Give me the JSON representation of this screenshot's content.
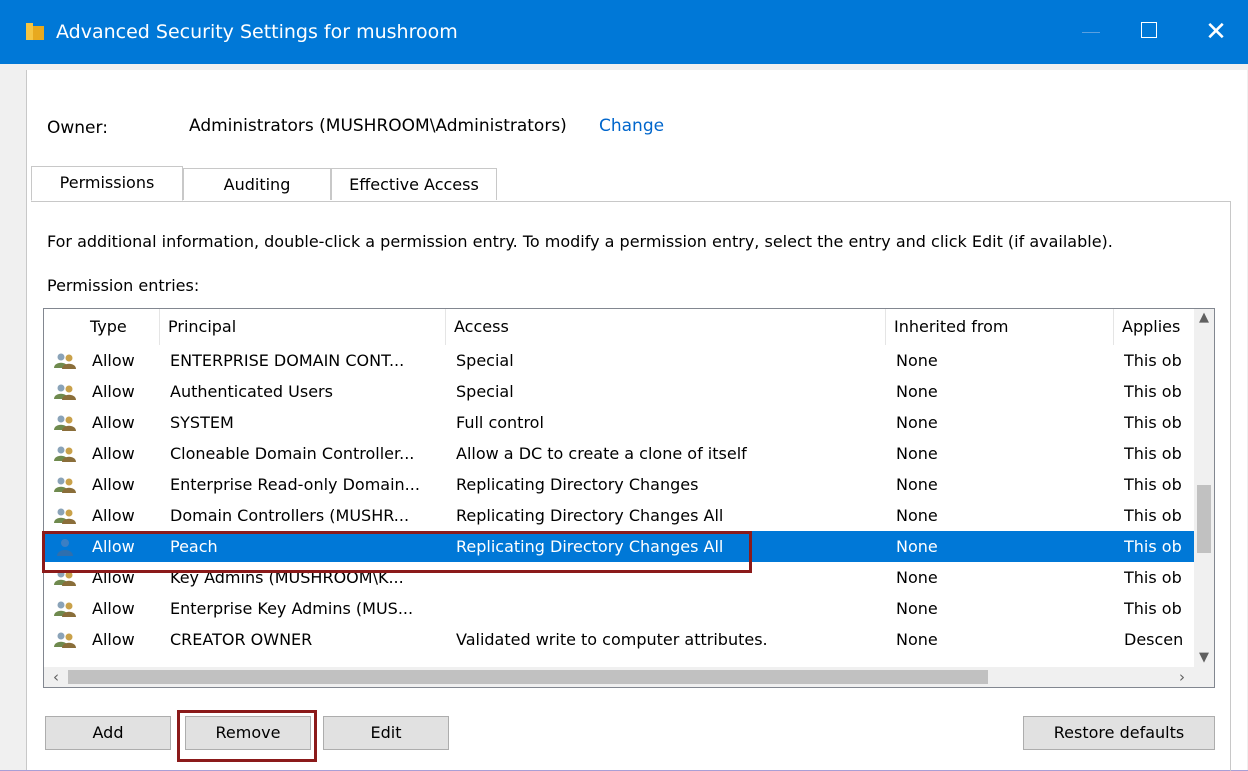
{
  "window": {
    "title": "Advanced Security Settings for mushroom",
    "close_glyph": "✕"
  },
  "owner": {
    "label": "Owner:",
    "value": "Administrators (MUSHROOM\\Administrators)",
    "change_link": "Change"
  },
  "tabs": [
    {
      "label": "Permissions",
      "active": true
    },
    {
      "label": "Auditing",
      "active": false
    },
    {
      "label": "Effective Access",
      "active": false
    }
  ],
  "info_text": "For additional information, double-click a permission entry. To modify a permission entry, select the entry and click Edit (if available).",
  "entries_label": "Permission entries:",
  "columns": [
    "Type",
    "Principal",
    "Access",
    "Inherited from",
    "Applies"
  ],
  "rows": [
    {
      "icon": "group-icon",
      "type": "Allow",
      "principal": "ENTERPRISE DOMAIN CONT...",
      "access": "Special",
      "inherited": "None",
      "applies": "This ob"
    },
    {
      "icon": "group-icon",
      "type": "Allow",
      "principal": "Authenticated Users",
      "access": "Special",
      "inherited": "None",
      "applies": "This ob"
    },
    {
      "icon": "group-icon",
      "type": "Allow",
      "principal": "SYSTEM",
      "access": "Full control",
      "inherited": "None",
      "applies": "This ob"
    },
    {
      "icon": "group-icon",
      "type": "Allow",
      "principal": "Cloneable Domain Controller...",
      "access": "Allow a DC to create a clone of itself",
      "inherited": "None",
      "applies": "This ob"
    },
    {
      "icon": "group-icon",
      "type": "Allow",
      "principal": "Enterprise Read-only Domain...",
      "access": "Replicating Directory Changes",
      "inherited": "None",
      "applies": "This ob"
    },
    {
      "icon": "group-icon",
      "type": "Allow",
      "principal": "Domain Controllers (MUSHR...",
      "access": "Replicating Directory Changes All",
      "inherited": "None",
      "applies": "This ob"
    },
    {
      "icon": "user-icon",
      "type": "Allow",
      "principal": "Peach",
      "access": "Replicating Directory Changes All",
      "inherited": "None",
      "applies": "This ob",
      "selected": true
    },
    {
      "icon": "group-icon",
      "type": "Allow",
      "principal": "Key Admins (MUSHROOM\\K...",
      "access": "",
      "inherited": "None",
      "applies": "This ob"
    },
    {
      "icon": "group-icon",
      "type": "Allow",
      "principal": "Enterprise Key Admins (MUS...",
      "access": "",
      "inherited": "None",
      "applies": "This ob"
    },
    {
      "icon": "group-icon",
      "type": "Allow",
      "principal": "CREATOR OWNER",
      "access": "Validated write to computer attributes.",
      "inherited": "None",
      "applies": "Descen"
    }
  ],
  "buttons": {
    "add": "Add",
    "remove": "Remove",
    "edit": "Edit",
    "restore": "Restore defaults"
  },
  "colors": {
    "titlebar": "#0078d7",
    "selection": "#0078d7",
    "link": "#0066cc",
    "highlight_box": "#8b1a1a"
  }
}
